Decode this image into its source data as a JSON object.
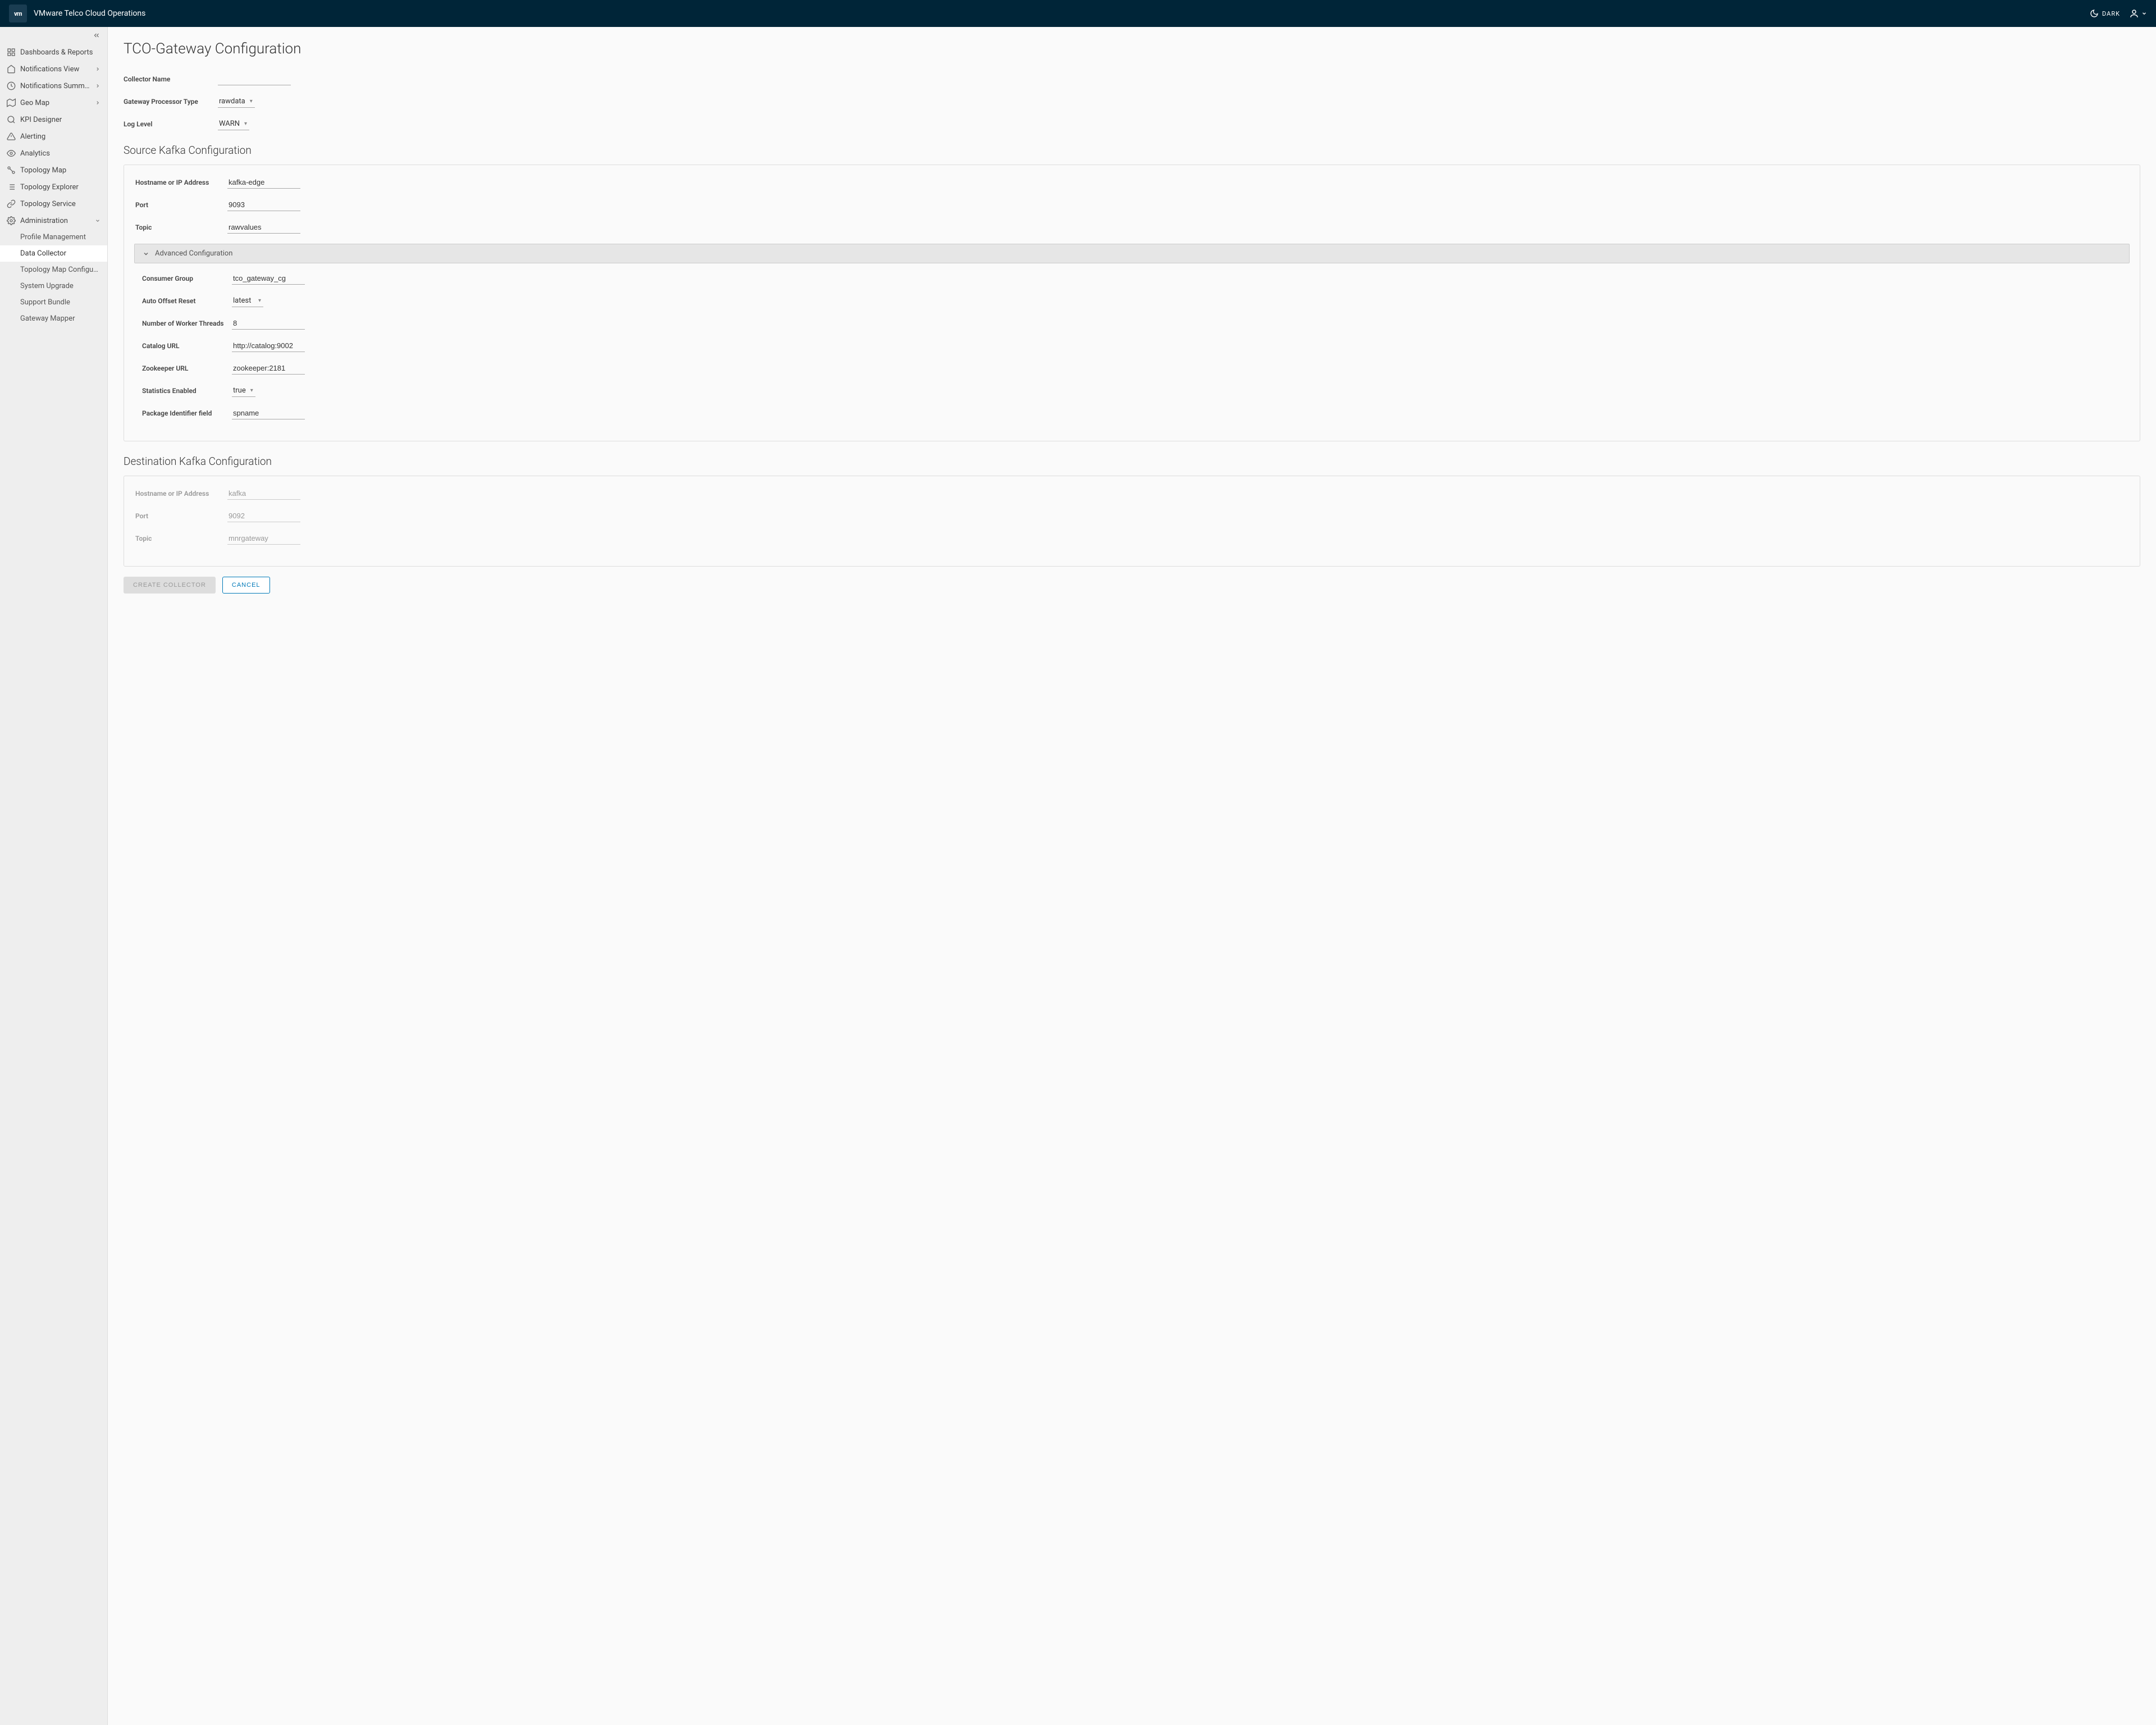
{
  "header": {
    "logo_text": "vm",
    "app_title": "VMware Telco Cloud Operations",
    "theme_label": "DARK"
  },
  "sidebar": {
    "items": [
      {
        "label": "Dashboards & Reports",
        "icon": "dashboard",
        "expandable": false
      },
      {
        "label": "Notifications View",
        "icon": "home",
        "expandable": true
      },
      {
        "label": "Notifications Summ…",
        "icon": "clock",
        "expandable": true
      },
      {
        "label": "Geo Map",
        "icon": "map",
        "expandable": true
      },
      {
        "label": "KPI Designer",
        "icon": "search",
        "expandable": false
      },
      {
        "label": "Alerting",
        "icon": "alert",
        "expandable": false
      },
      {
        "label": "Analytics",
        "icon": "eye",
        "expandable": false
      },
      {
        "label": "Topology Map",
        "icon": "topo",
        "expandable": false
      },
      {
        "label": "Topology Explorer",
        "icon": "list",
        "expandable": false
      },
      {
        "label": "Topology Service",
        "icon": "link",
        "expandable": false
      },
      {
        "label": "Administration",
        "icon": "gear",
        "expandable": true,
        "expanded": true
      }
    ],
    "admin_sub": [
      {
        "label": "Profile Management"
      },
      {
        "label": "Data Collector",
        "active": true
      },
      {
        "label": "Topology Map Configurat…"
      },
      {
        "label": "System Upgrade"
      },
      {
        "label": "Support Bundle"
      },
      {
        "label": "Gateway Mapper"
      }
    ]
  },
  "page": {
    "title": "TCO-Gateway Configuration",
    "collector_name_label": "Collector Name",
    "collector_name_value": "",
    "gateway_proc_label": "Gateway Processor Type",
    "gateway_proc_value": "rawdata",
    "log_level_label": "Log Level",
    "log_level_value": "WARN",
    "source_section": "Source Kafka Configuration",
    "src_host_label": "Hostname or IP Address",
    "src_host_value": "kafka-edge",
    "src_port_label": "Port",
    "src_port_value": "9093",
    "src_topic_label": "Topic",
    "src_topic_value": "rawvalues",
    "adv_title": "Advanced Configuration",
    "cg_label": "Consumer Group",
    "cg_value": "tco_gateway_cg",
    "aor_label": "Auto Offset Reset",
    "aor_value": "latest",
    "workers_label": "Number of Worker Threads",
    "workers_value": "8",
    "catalog_label": "Catalog URL",
    "catalog_value": "http://catalog:9002",
    "zk_label": "Zookeeper URL",
    "zk_value": "zookeeper:2181",
    "stats_label": "Statistics Enabled",
    "stats_value": "true",
    "pkg_label": "Package Identifier field",
    "pkg_value": "spname",
    "dest_section": "Destination Kafka Configuration",
    "dst_host_label": "Hostname or IP Address",
    "dst_host_value": "kafka",
    "dst_port_label": "Port",
    "dst_port_value": "9092",
    "dst_topic_label": "Topic",
    "dst_topic_value": "mnrgateway",
    "create_btn": "CREATE COLLECTOR",
    "cancel_btn": "CANCEL"
  }
}
